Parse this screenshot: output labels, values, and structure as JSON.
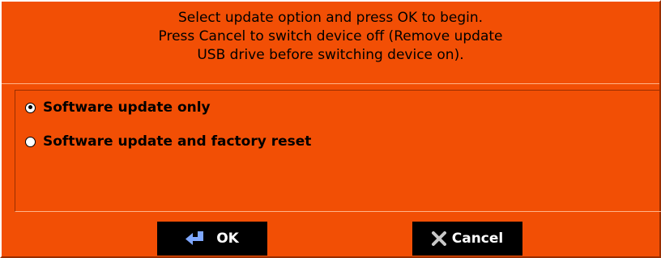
{
  "dialog": {
    "message_lines": [
      "Select update option and press OK to begin.",
      "Press Cancel to switch device off (Remove update",
      "USB drive before switching device on)."
    ],
    "options": [
      {
        "label": "Software update only",
        "selected": true
      },
      {
        "label": "Software update and factory reset",
        "selected": false
      }
    ],
    "buttons": {
      "ok_label": "OK",
      "ok_icon": "enter-arrow-icon",
      "cancel_label": "Cancel",
      "cancel_icon": "x-close-icon"
    }
  },
  "colors": {
    "dialog_background": "#f24f05",
    "button_background": "#000000",
    "button_text": "#ffffff"
  }
}
